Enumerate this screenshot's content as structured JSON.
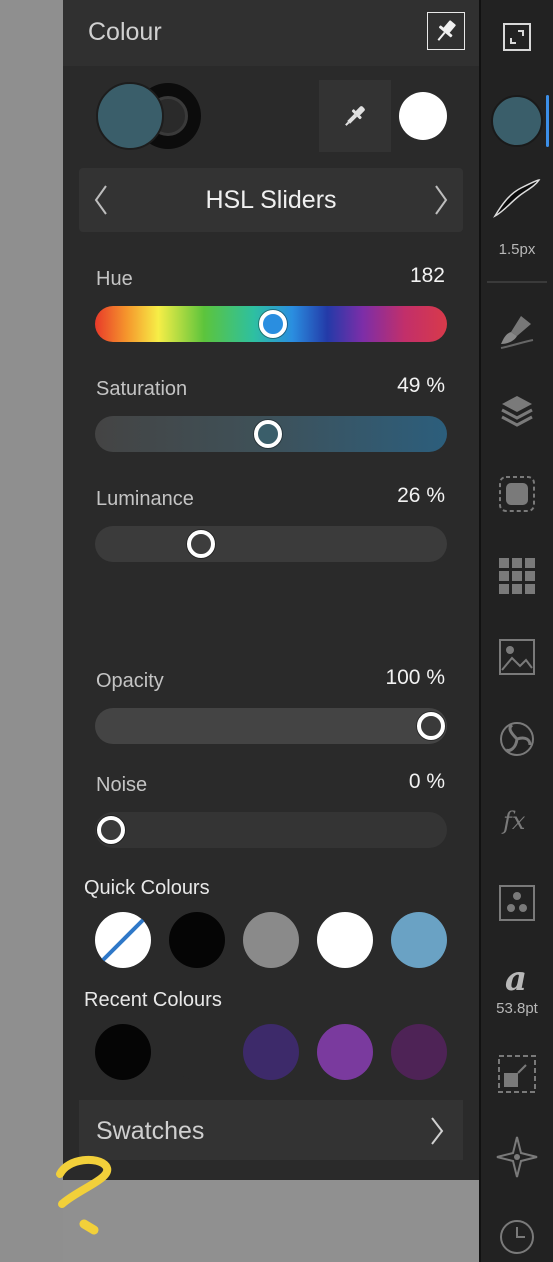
{
  "colour_panel": {
    "title": "Colour",
    "colors": {
      "fill": "#3a5e6a",
      "stroke": "#0c0c0c",
      "picked": "#ffffff"
    },
    "mode": {
      "label": "HSL Sliders"
    },
    "sliders": {
      "hue": {
        "label": "Hue",
        "value_text": "182",
        "position": 0.506
      },
      "saturation": {
        "label": "Saturation",
        "value_text": "49 %",
        "position": 0.49
      },
      "luminance": {
        "label": "Luminance",
        "value_text": "26 %",
        "position": 0.28
      },
      "opacity": {
        "label": "Opacity",
        "value_text": "100 %",
        "position": 1.0
      },
      "noise": {
        "label": "Noise",
        "value_text": "0 %",
        "position": 0.0
      }
    },
    "quick_colours": {
      "title": "Quick Colours",
      "swatches": [
        "none",
        "#050505",
        "#8a8a8a",
        "#ffffff",
        "#6aa2c4"
      ]
    },
    "recent_colours": {
      "title": "Recent Colours",
      "swatches": [
        "#050505",
        "#2a2a2a",
        "#3d2a6a",
        "#7a3a9e",
        "#4e2356"
      ]
    },
    "swatches_button": {
      "label": "Swatches"
    }
  },
  "toolbar": {
    "stroke_width_label": "1.5px",
    "font_size_label": "53.8pt",
    "accent": "#3c8fe8",
    "icons": [
      "fullscreen-icon",
      "colour-icon",
      "stroke-icon",
      "brush-icon",
      "layers-icon",
      "effects-icon",
      "swatches-grid-icon",
      "image-icon",
      "adjustments-icon",
      "fx-icon",
      "channels-icon",
      "text-style-icon",
      "transform-icon",
      "navigator-icon",
      "history-icon"
    ]
  }
}
